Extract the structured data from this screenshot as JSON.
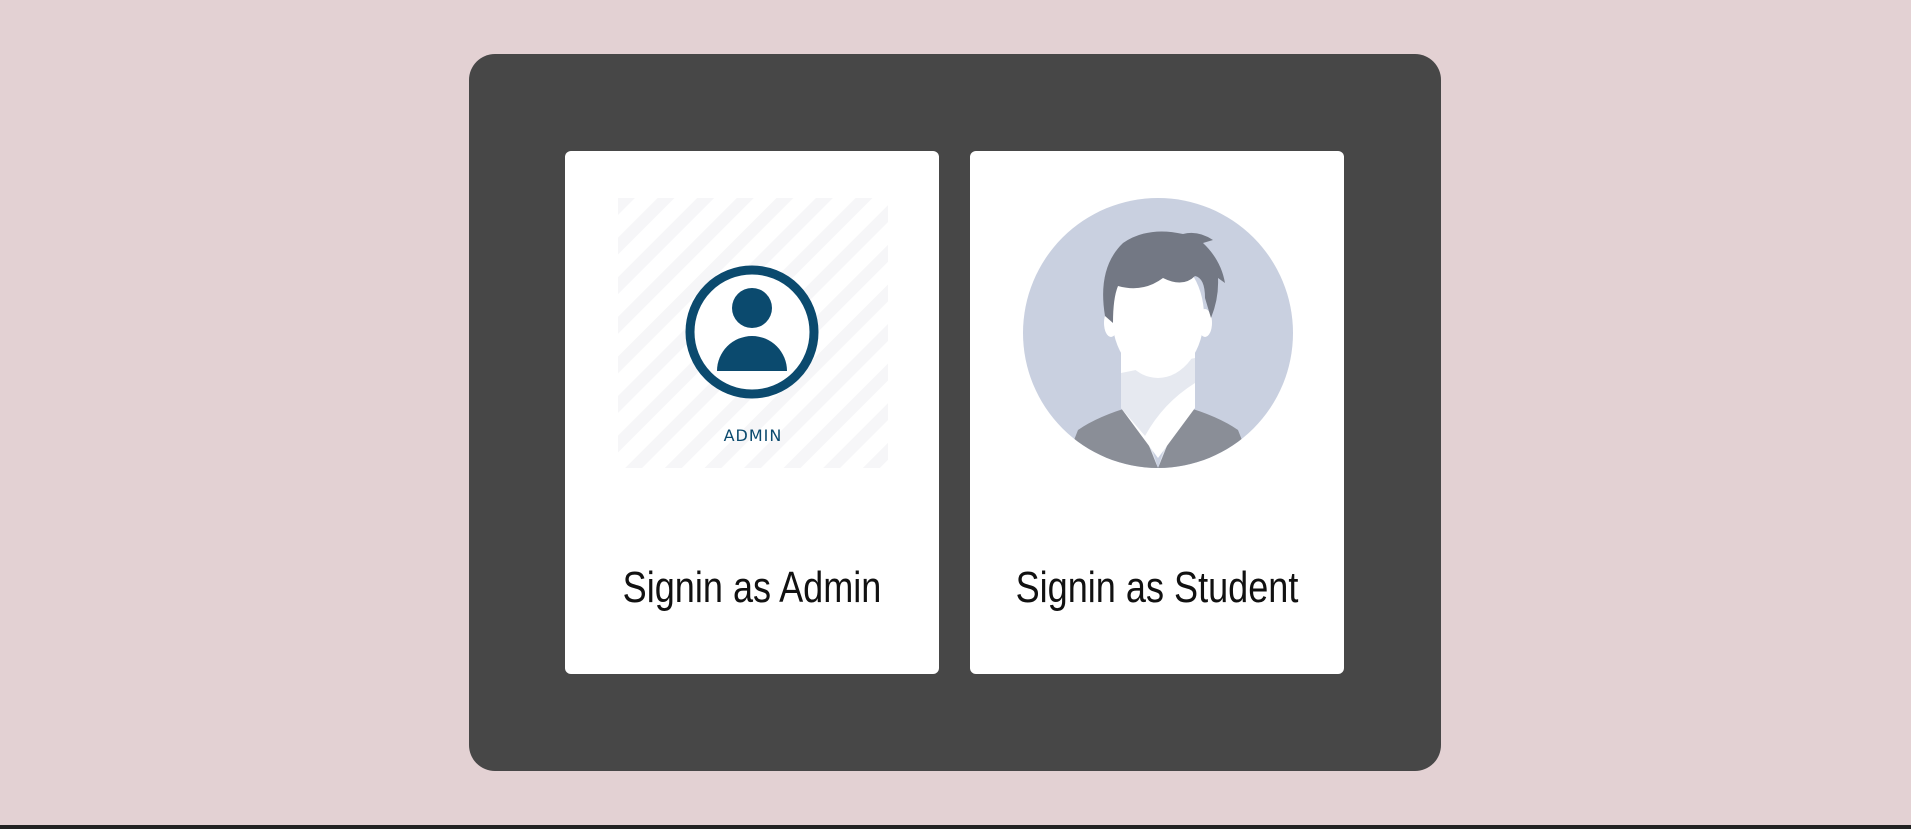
{
  "cards": [
    {
      "id": "admin",
      "title": "Signin as Admin",
      "image_caption": "ADMIN",
      "icon": "admin-user-icon",
      "accent": "#0b4a6e"
    },
    {
      "id": "student",
      "title": "Signin as Student",
      "icon": "student-avatar-icon",
      "avatar_bg": "#c9d0e0",
      "hair_color": "#737884",
      "shirt_color": "#8a8e97"
    }
  ],
  "colors": {
    "page_bg": "#e3d1d3",
    "panel_bg": "#474747",
    "card_bg": "#ffffff"
  }
}
